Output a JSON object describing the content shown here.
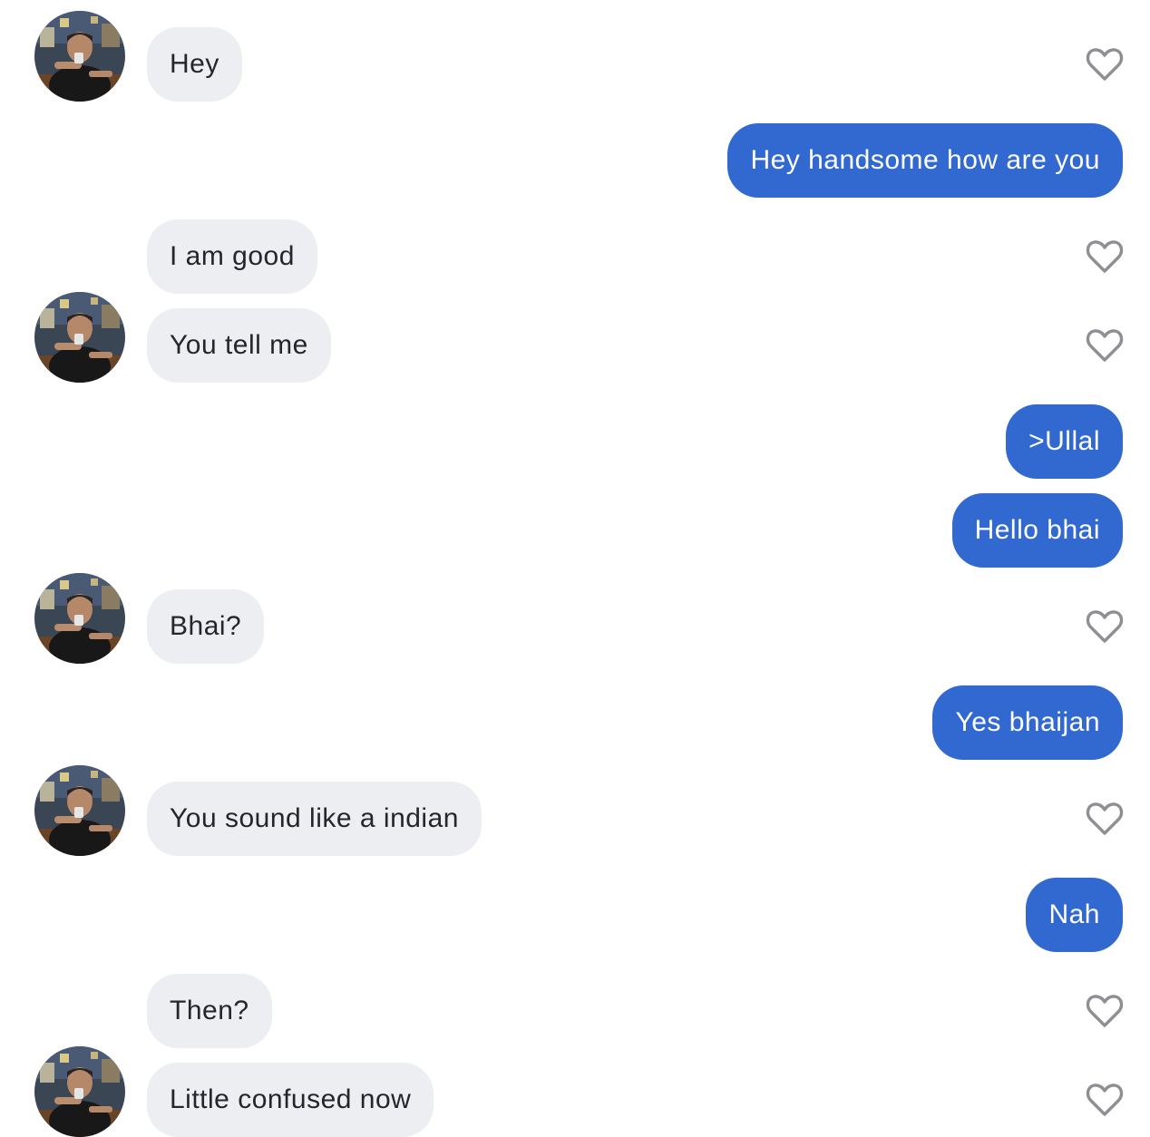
{
  "messages": [
    {
      "from": "them",
      "text": "Hey"
    },
    {
      "from": "me",
      "text": "Hey handsome how are you"
    },
    {
      "from": "them",
      "text": "I am good"
    },
    {
      "from": "them",
      "text": "You tell me"
    },
    {
      "from": "me",
      "text": ">Ullal"
    },
    {
      "from": "me",
      "text": "Hello bhai"
    },
    {
      "from": "them",
      "text": "Bhai?"
    },
    {
      "from": "me",
      "text": "Yes bhaijan"
    },
    {
      "from": "them",
      "text": "You sound like a indian"
    },
    {
      "from": "me",
      "text": "Nah"
    },
    {
      "from": "them",
      "text": "Then?"
    },
    {
      "from": "them",
      "text": "Little confused now"
    }
  ],
  "icons": {
    "like": "heart-outline-icon",
    "avatar": "profile-photo"
  },
  "colors": {
    "incoming_bubble": "#eceef2",
    "incoming_text": "#24262b",
    "outgoing_bubble": "#3169d0",
    "outgoing_text": "#ffffff",
    "heart_stroke": "#8e8e93"
  }
}
